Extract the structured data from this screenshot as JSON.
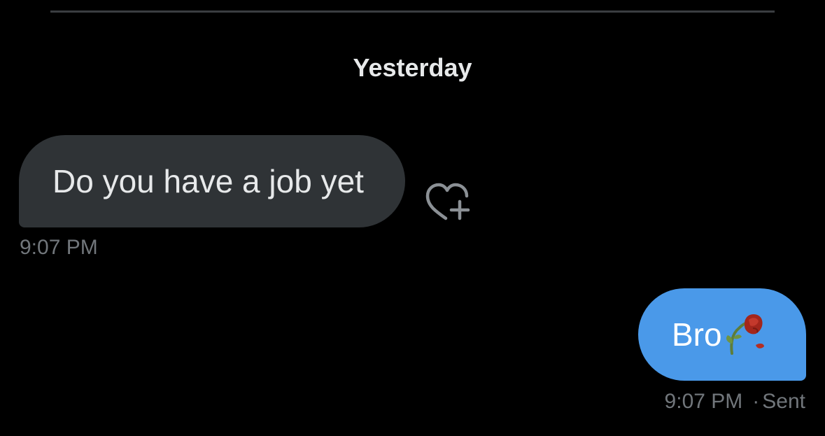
{
  "conversation": {
    "date_header": "Yesterday",
    "messages": [
      {
        "direction": "incoming",
        "text": "Do you have a job yet",
        "time": "9:07 PM",
        "reaction_icon": "heart-plus-icon"
      },
      {
        "direction": "outgoing",
        "text": "Bro",
        "emoji": "wilted-flower-icon",
        "time": "9:07 PM",
        "separator": "·",
        "status": "Sent"
      }
    ]
  },
  "colors": {
    "background": "#000000",
    "incoming_bubble": "#2f3336",
    "outgoing_bubble": "#4a99e9",
    "secondary_text": "#71767b",
    "primary_text": "#e7e9ea"
  }
}
